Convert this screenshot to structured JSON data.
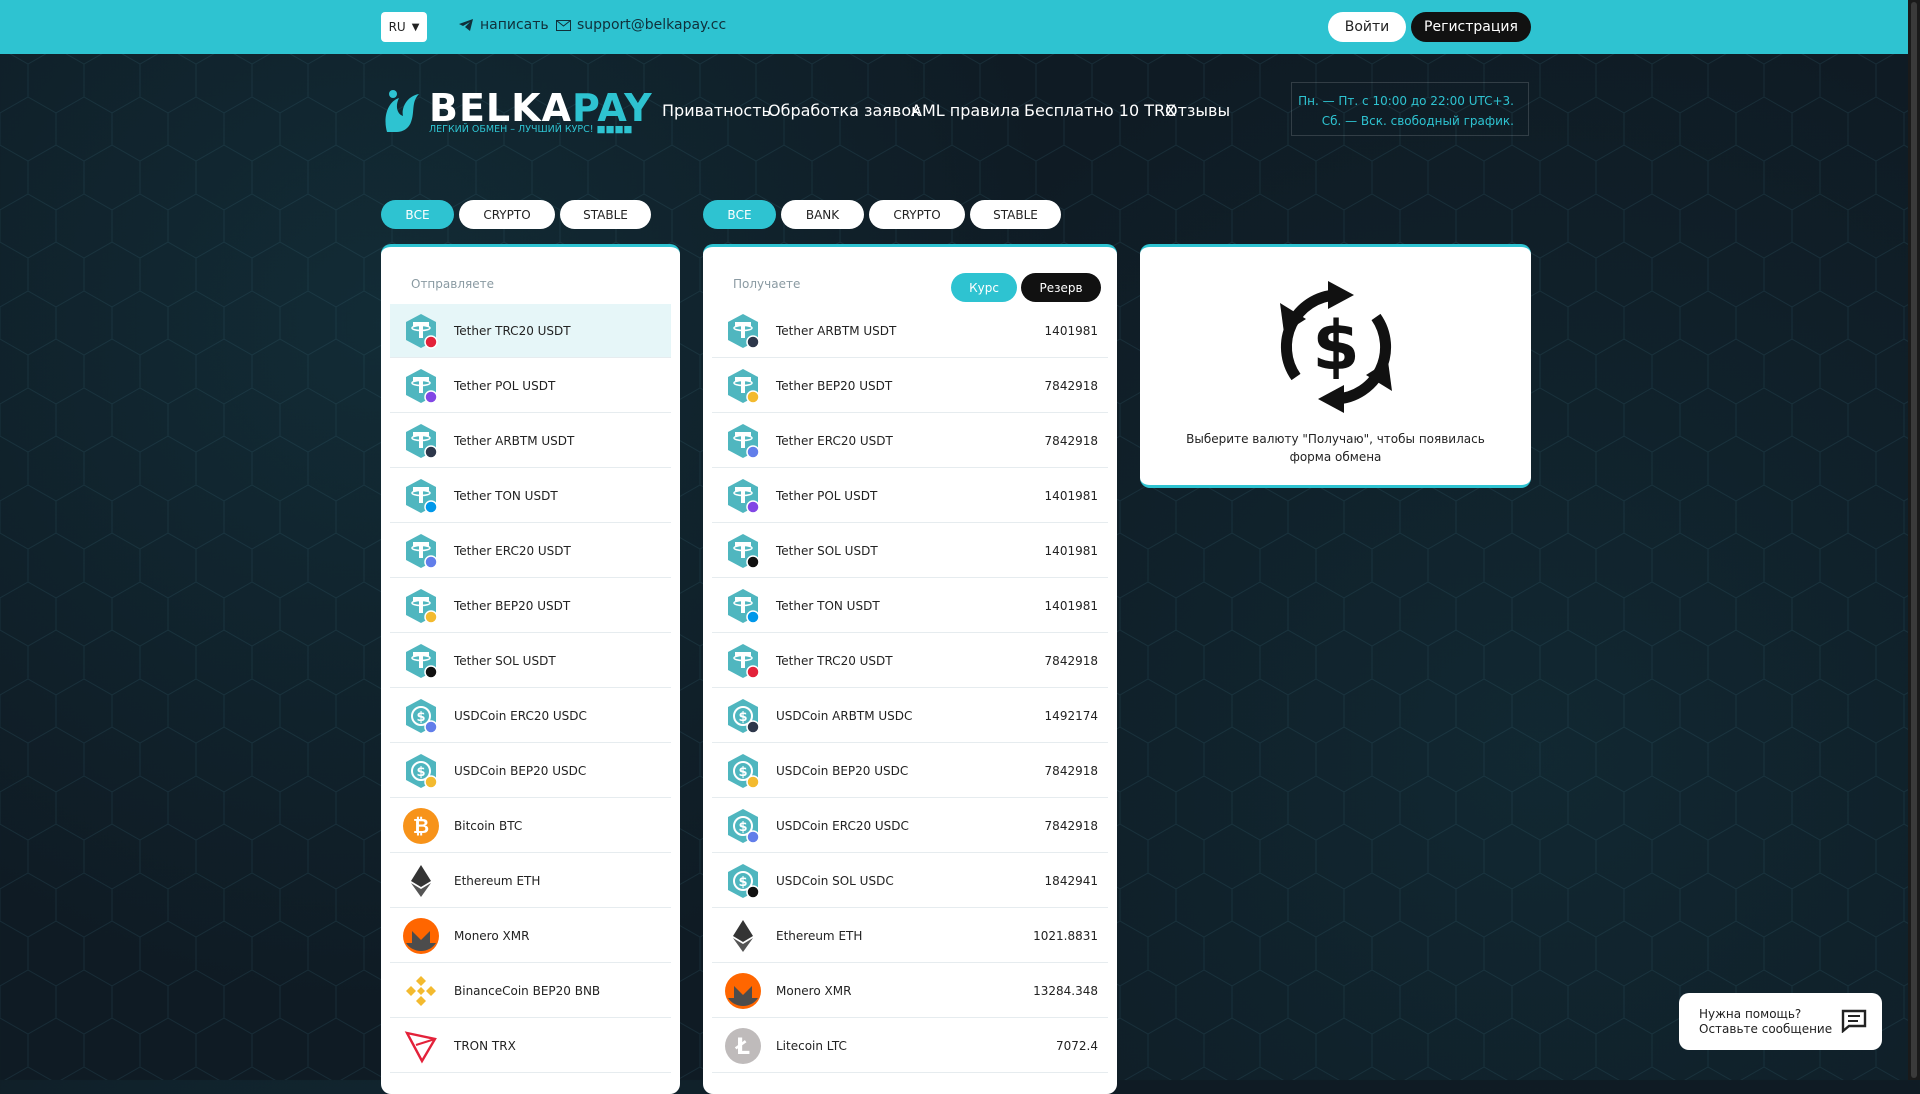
{
  "topbar": {
    "lang": "RU",
    "write_label": "написать",
    "email": "support@belkapay.cc",
    "login_label": "Войти",
    "register_label": "Регистрация"
  },
  "logo": {
    "word_main": "BELKA",
    "word_accent": "PAY",
    "tagline": "ЛЕГКИЙ ОБМЕН – ЛУЧШИЙ КУРС!"
  },
  "nav": [
    "Приватность",
    "Обработка заявок",
    "AML правила",
    "Бесплатно 10 TRX",
    "Отзывы"
  ],
  "hours": {
    "line1": "Пн. — Пт. с 10:00 до 22:00 UTC+3.",
    "line2": "Сб. — Вск. свободный график."
  },
  "filters_send": [
    "ВСЕ",
    "CRYPTO",
    "STABLE"
  ],
  "filters_receive": [
    "ВСЕ",
    "BANK",
    "CRYPTO",
    "STABLE"
  ],
  "send": {
    "header": "Отправляете",
    "items": [
      {
        "name": "Tether TRC20 USDT",
        "icon": "tether",
        "badge": "#e3223a"
      },
      {
        "name": "Tether POL USDT",
        "icon": "tether",
        "badge": "#8247e5"
      },
      {
        "name": "Tether ARBTM USDT",
        "icon": "tether",
        "badge": "#2d374b"
      },
      {
        "name": "Tether TON USDT",
        "icon": "tether",
        "badge": "#0098ea"
      },
      {
        "name": "Tether ERC20 USDT",
        "icon": "tether",
        "badge": "#627eea"
      },
      {
        "name": "Tether BEP20 USDT",
        "icon": "tether",
        "badge": "#f3ba2f"
      },
      {
        "name": "Tether SOL USDT",
        "icon": "tether",
        "badge": "#111111"
      },
      {
        "name": "USDCoin ERC20 USDC",
        "icon": "usdc",
        "badge": "#627eea"
      },
      {
        "name": "USDCoin BEP20 USDC",
        "icon": "usdc",
        "badge": "#f3ba2f"
      },
      {
        "name": "Bitcoin BTC",
        "icon": "btc",
        "badge": ""
      },
      {
        "name": "Ethereum ETH",
        "icon": "eth",
        "badge": ""
      },
      {
        "name": "Monero XMR",
        "icon": "xmr",
        "badge": ""
      },
      {
        "name": "BinanceCoin BEP20 BNB",
        "icon": "bnb",
        "badge": ""
      },
      {
        "name": "TRON TRX",
        "icon": "trx",
        "badge": ""
      }
    ]
  },
  "receive": {
    "header": "Получаете",
    "kurs_label": "Курс",
    "reserve_label": "Резерв",
    "items": [
      {
        "name": "Tether ARBTM USDT",
        "value": "1401981",
        "icon": "tether",
        "badge": "#2d374b"
      },
      {
        "name": "Tether BEP20 USDT",
        "value": "7842918",
        "icon": "tether",
        "badge": "#f3ba2f"
      },
      {
        "name": "Tether ERC20 USDT",
        "value": "7842918",
        "icon": "tether",
        "badge": "#627eea"
      },
      {
        "name": "Tether POL USDT",
        "value": "1401981",
        "icon": "tether",
        "badge": "#8247e5"
      },
      {
        "name": "Tether SOL USDT",
        "value": "1401981",
        "icon": "tether",
        "badge": "#111111"
      },
      {
        "name": "Tether TON USDT",
        "value": "1401981",
        "icon": "tether",
        "badge": "#0098ea"
      },
      {
        "name": "Tether TRC20 USDT",
        "value": "7842918",
        "icon": "tether",
        "badge": "#e3223a"
      },
      {
        "name": "USDCoin ARBTM USDC",
        "value": "1492174",
        "icon": "usdc",
        "badge": "#2d374b"
      },
      {
        "name": "USDCoin BEP20 USDC",
        "value": "7842918",
        "icon": "usdc",
        "badge": "#f3ba2f"
      },
      {
        "name": "USDCoin ERC20 USDC",
        "value": "7842918",
        "icon": "usdc",
        "badge": "#627eea"
      },
      {
        "name": "USDCoin SOL USDC",
        "value": "1842941",
        "icon": "usdc",
        "badge": "#111111"
      },
      {
        "name": "Ethereum ETH",
        "value": "1021.8831",
        "icon": "eth",
        "badge": ""
      },
      {
        "name": "Monero XMR",
        "value": "13284.348",
        "icon": "xmr",
        "badge": ""
      },
      {
        "name": "Litecoin LTC",
        "value": "7072.4",
        "icon": "ltc",
        "badge": ""
      }
    ]
  },
  "info": {
    "text": "Выберите валюту \"Получаю\", чтобы появилась форма обмена"
  },
  "help": {
    "line1": "Нужна помощь?",
    "line2": "Оставьте сообщение"
  },
  "colors": {
    "accent": "#2ec3d1",
    "dark": "#111111",
    "bg": "#0f1b24"
  }
}
